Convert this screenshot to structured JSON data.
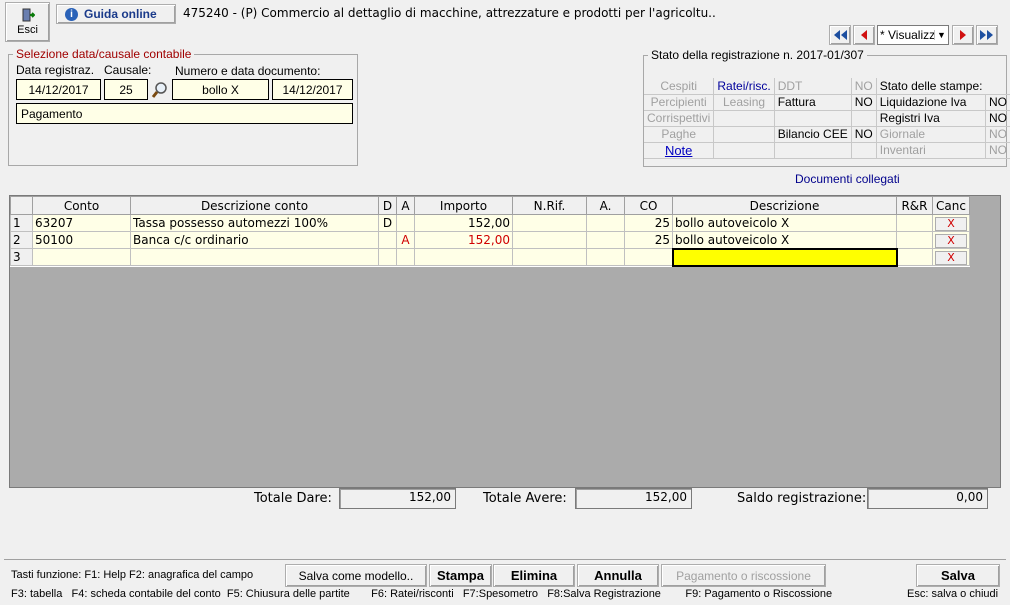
{
  "toolbar": {
    "esci_label": "Esci",
    "guida_label": "Guida online",
    "title": "475240 - (P) Commercio al dettaglio di macchine, attrezzature e prodotti per l'agricoltu..",
    "view_select": "* Visualizz"
  },
  "selezione": {
    "group_label": "Selezione data/causale contabile",
    "data_label": "Data registraz.",
    "causale_label": "Causale:",
    "numero_label": "Numero e data documento:",
    "data_value": "14/12/2017",
    "causale_value": "25",
    "numero_value": "bollo X",
    "data_doc_value": "14/12/2017",
    "descrizione_value": "Pagamento"
  },
  "stato": {
    "group_label": "Stato della registrazione n. 2017-01/307",
    "cespiti": "Cespiti",
    "ratei": "Ratei/risc.",
    "ddt": "DDT",
    "ddt_val": "NO",
    "percipienti": "Percipienti",
    "leasing": "Leasing",
    "fattura": "Fattura",
    "fattura_val": "NO",
    "corrispettivi": "Corrispettivi",
    "paghe": "Paghe",
    "bilancio": "Bilancio CEE",
    "bilancio_val": "NO",
    "note": "Note",
    "stampe_label": "Stato delle stampe:",
    "liquidazione": "Liquidazione Iva",
    "liquidazione_val": "NO",
    "registri": "Registri Iva",
    "registri_val": "NO",
    "giornale": "Giornale",
    "giornale_val": "NO",
    "inventari": "Inventari",
    "inventari_val": "NO",
    "documenti_collegati": "Documenti collegati"
  },
  "grid": {
    "headers": [
      "Conto",
      "Descrizione conto",
      "D",
      "A",
      "Importo",
      "N.Rif.",
      "A.",
      "CO",
      "Descrizione",
      "R&R",
      "Canc"
    ],
    "rows": [
      {
        "n": "1",
        "conto": "63207",
        "desc_conto": "Tassa possesso automezzi 100%",
        "d": "D",
        "a": "",
        "importo": "152,00",
        "co": "25",
        "descrizione": "bollo autoveicolo X",
        "canc": "X"
      },
      {
        "n": "2",
        "conto": "50100",
        "desc_conto": "Banca c/c ordinario",
        "d": "",
        "a": "A",
        "importo": "152,00",
        "co": "25",
        "descrizione": "bollo autoveicolo X",
        "canc": "X"
      },
      {
        "n": "3",
        "conto": "",
        "desc_conto": "",
        "d": "",
        "a": "",
        "importo": "",
        "co": "",
        "descrizione": "",
        "canc": "X"
      }
    ]
  },
  "totali": {
    "dare_label": "Totale Dare:",
    "dare_value": "152,00",
    "avere_label": "Totale Avere:",
    "avere_value": "152,00",
    "saldo_label": "Saldo registrazione:",
    "saldo_value": "0,00"
  },
  "footer": {
    "tasti_line1": "Tasti funzione: F1: Help  F2: anagrafica del campo",
    "tasti_line2": "F3: tabella   F4: scheda contabile del conto  F5: Chiusura delle partite       F6: Ratei/risconti   F7:Spesometro   F8:Salva Registrazione        F9: Pagamento o Riscossione",
    "salva_modello": "Salva come modello..",
    "stampa": "Stampa",
    "elimina": "Elimina",
    "annulla": "Annulla",
    "pagamento": "Pagamento o riscossione",
    "salva": "Salva",
    "esc_hint": "Esc: salva o chiudi"
  }
}
